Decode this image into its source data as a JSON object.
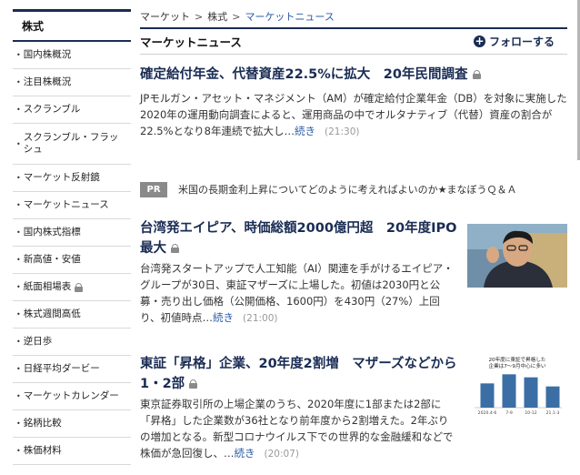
{
  "sidebar": {
    "heading": "株式",
    "items": [
      {
        "label": "国内株概況"
      },
      {
        "label": "注目株概況"
      },
      {
        "label": "スクランブル"
      },
      {
        "label": "スクランブル・フラッシュ"
      },
      {
        "label": "マーケット反射鏡"
      },
      {
        "label": "マーケットニュース"
      },
      {
        "label": "国内株式指標"
      },
      {
        "label": "新高値・安値"
      },
      {
        "label": "紙面相場表",
        "locked": true
      },
      {
        "label": "株式週間高低"
      },
      {
        "label": "逆日歩"
      },
      {
        "label": "日経平均ダービー"
      },
      {
        "label": "マーケットカレンダー"
      },
      {
        "label": "銘柄比較"
      },
      {
        "label": "株価材料"
      }
    ]
  },
  "breadcrumb": {
    "items": [
      "マーケット",
      "株式",
      "マーケットニュース"
    ],
    "sep": ">"
  },
  "section": {
    "title": "マーケットニュース",
    "follow_label": "フォローする"
  },
  "articles": [
    {
      "title": "確定給付年金、代替資産22.5%に拡大　20年民間調査",
      "body": "JPモルガン・アセット・マネジメント（AM）が確定給付企業年金（DB）を対象に実施した2020年の運用動向調査によると、運用商品の中でオルタナティブ（代替）資産の割合が22.5%となり8年連続で拡大し…",
      "more": "続き",
      "time": "(21:30)"
    },
    {
      "title": "台湾発エイピア、時価総額2000億円超　20年度IPO最大",
      "body": "台湾発スタートアップで人工知能（AI）関連を手がけるエイピア・グループが30日、東証マザーズに上場した。初値は2030円と公募・売り出し価格（公開価格、1600円）を430円（27%）上回り、初値時点…",
      "more": "続き",
      "time": "(21:00)"
    },
    {
      "title": "東証「昇格」企業、20年度2割増　マザーズなどから1・2部",
      "body": "東京証券取引所の上場企業のうち、2020年度に1部または2部に「昇格」した企業数が36社となり前年度から2割増えた。2年ぶりの増加となる。新型コロナウイルス下での世界的な金融緩和などで株価が急回復し、…",
      "more": "続き",
      "time": "(20:07)"
    }
  ],
  "pr": {
    "tag": "PR",
    "text": "米国の長期金利上昇についてどのように考えればよいのか★まなぼうＱ＆Ａ"
  },
  "thumb_chart": {
    "title_line1": "20年度に東証で昇格した",
    "title_line2": "企業は7～9月中心に多い",
    "categories": [
      "2020.4-6",
      "7-9",
      "10-12",
      "21.1-3"
    ],
    "values": [
      8,
      11,
      10,
      7
    ],
    "color": "#3b6ea5"
  },
  "colors": {
    "navy": "#1a2c54",
    "link": "#2a5ba8",
    "muted": "#999999"
  }
}
